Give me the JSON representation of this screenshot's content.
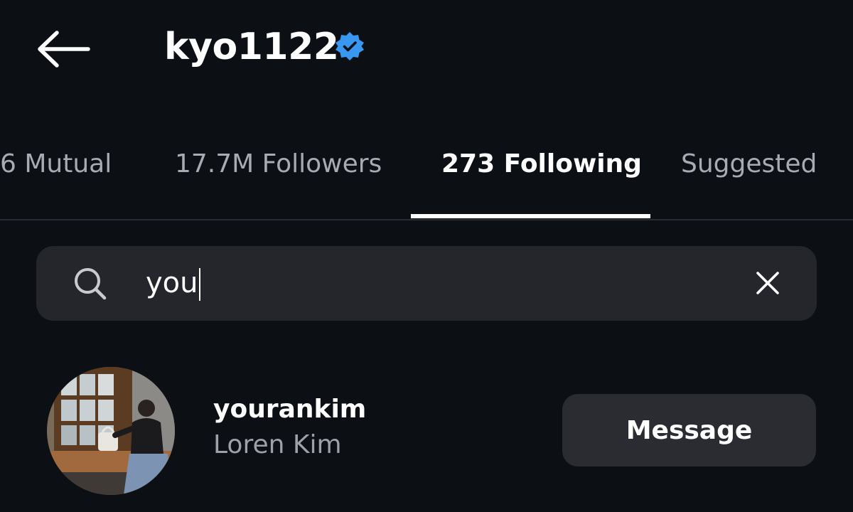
{
  "header": {
    "title": "kyo1122",
    "verified": true,
    "back_icon": "arrow-left-icon",
    "verified_icon": "verified-badge-icon"
  },
  "tabs": [
    {
      "label": "6 Mutual",
      "active": false
    },
    {
      "label": "17.7M Followers",
      "active": false
    },
    {
      "label": "273 Following",
      "active": true
    },
    {
      "label": "Suggested",
      "active": false
    }
  ],
  "search": {
    "value": "you",
    "search_icon": "search-icon",
    "clear_icon": "close-icon"
  },
  "results": [
    {
      "username": "yourankim",
      "full_name": "Loren Kim",
      "action_label": "Message"
    }
  ],
  "colors": {
    "background": "#0c0f14",
    "verified_blue": "#3897f0",
    "search_bg": "#24262b",
    "button_bg": "#2a2c31",
    "muted_text": "#a8abb2"
  }
}
